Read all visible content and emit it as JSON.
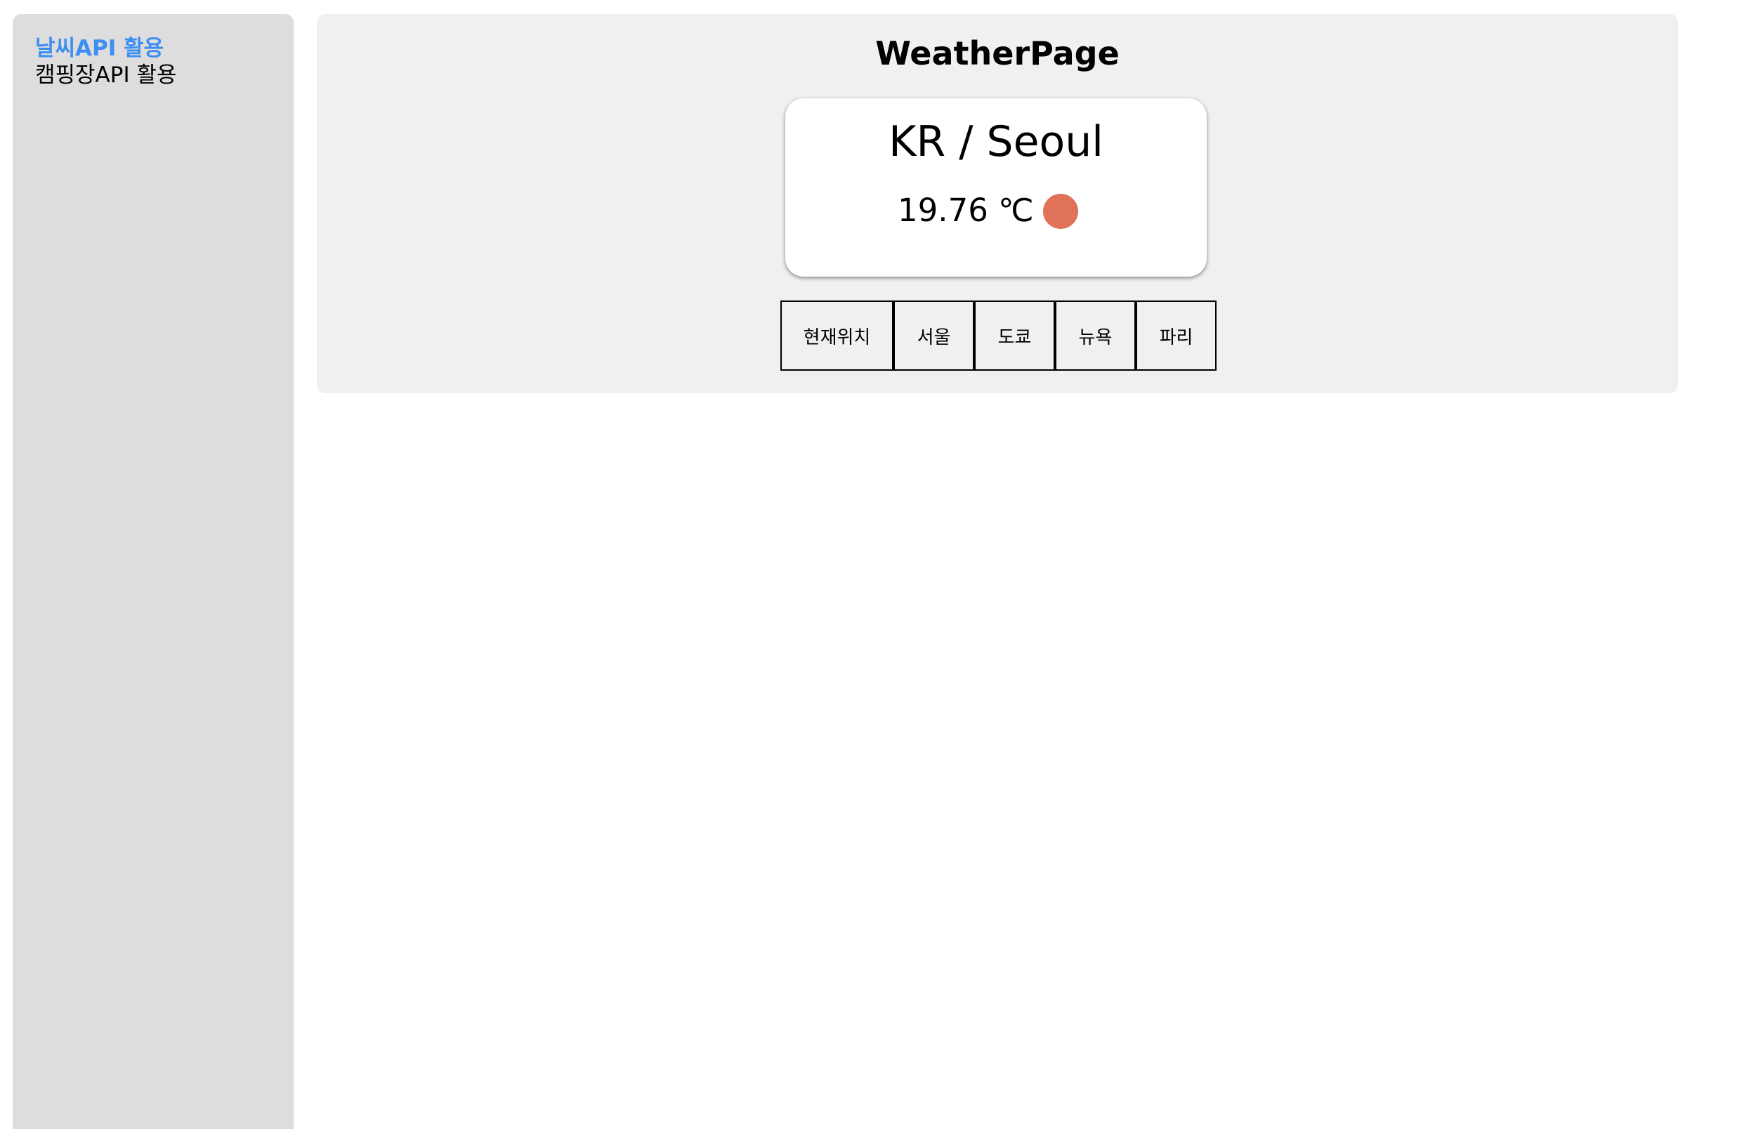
{
  "sidebar": {
    "items": [
      {
        "label": "날씨API 활용",
        "active": true
      },
      {
        "label": "캠핑장API 활용",
        "active": false
      }
    ]
  },
  "page": {
    "title": "WeatherPage"
  },
  "weather_card": {
    "location": "KR / Seoul",
    "temperature": "19.76 ℃",
    "icon": "sun-icon",
    "icon_color": "#df7258"
  },
  "city_buttons": [
    {
      "label": "현재위치"
    },
    {
      "label": "서울"
    },
    {
      "label": "도쿄"
    },
    {
      "label": "뉴욕"
    },
    {
      "label": "파리"
    }
  ],
  "colors": {
    "active_link": "#3f8ff2",
    "sidebar_bg": "#dddddd",
    "panel_bg": "#f0f0f0"
  }
}
